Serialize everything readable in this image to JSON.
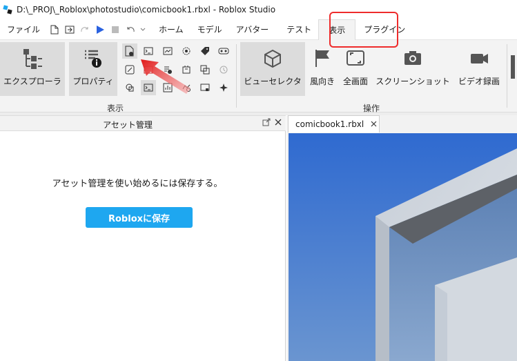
{
  "window": {
    "title": "D:\\_PROJ\\_Roblox\\photostudio\\comicbook1.rbxl - Roblox Studio",
    "app_icon": "roblox-studio-icon"
  },
  "menubar": {
    "file_label": "ファイル",
    "tabs": [
      {
        "label": "ホーム"
      },
      {
        "label": "モデル"
      },
      {
        "label": "アバター"
      },
      {
        "label": "テスト"
      },
      {
        "label": "表示"
      },
      {
        "label": "プラグイン"
      }
    ],
    "active_tab": "表示"
  },
  "ribbon": {
    "explorer_label": "エクスプローラ",
    "properties_label": "プロパティ",
    "view_group_label": "表示",
    "viewselector_label": "ビューセレクタ",
    "wind_label": "風向き",
    "fullscreen_label": "全画面",
    "screenshot_label": "スクリーンショット",
    "video_label": "ビデオ録画",
    "actions_group_label": "操作"
  },
  "asset_panel": {
    "title": "アセット管理",
    "message": "アセット管理を使い始めるには保存する。",
    "save_button_label": "Robloxに保存"
  },
  "document": {
    "tab_label": "comicbook1.rbxl"
  },
  "colors": {
    "accent": "#1ea7f0",
    "highlight": "#ee2b2b",
    "play": "#2a62e0"
  }
}
